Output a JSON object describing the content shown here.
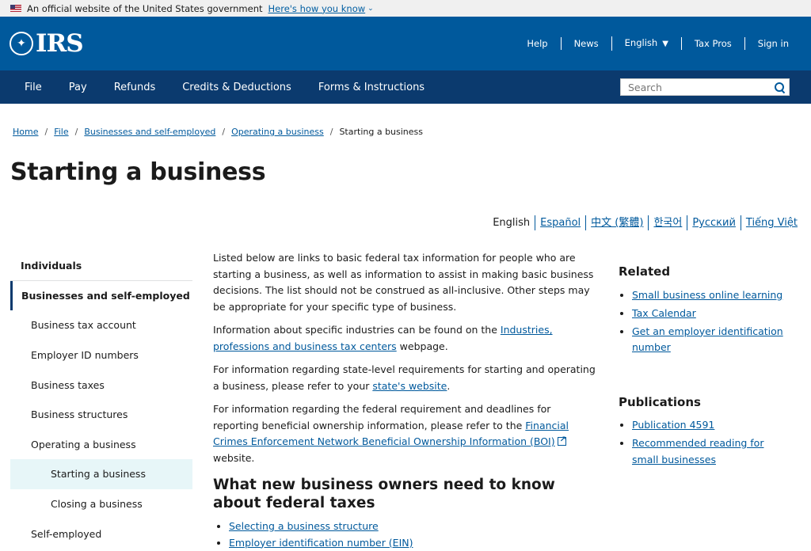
{
  "gov_banner": {
    "text": "An official website of the United States government",
    "link": "Here's how you know"
  },
  "header": {
    "logo_text": "IRS",
    "util_nav": [
      "Help",
      "News",
      "English",
      "Tax Pros",
      "Sign in"
    ]
  },
  "main_nav": {
    "items": [
      "File",
      "Pay",
      "Refunds",
      "Credits & Deductions",
      "Forms & Instructions"
    ],
    "search_placeholder": "Search"
  },
  "breadcrumb": {
    "items": [
      "Home",
      "File",
      "Businesses and self-employed",
      "Operating a business"
    ],
    "current": "Starting a business"
  },
  "page_title": "Starting a business",
  "languages": [
    "English",
    "Español",
    "中文 (繁體)",
    "한국어",
    "Русский",
    "Tiếng Việt"
  ],
  "sidebar": {
    "items": [
      "Individuals",
      "Businesses and self-employed",
      "Business tax account",
      "Employer ID numbers",
      "Business taxes",
      "Business structures",
      "Operating a business",
      "Starting a business",
      "Closing a business",
      "Self-employed"
    ]
  },
  "content": {
    "p1": "Listed below are links to basic federal tax information for people who are starting a business, as well as information to assist in making basic business decisions. The list should not be construed as all-inclusive. Other steps may be appropriate for your specific type of business.",
    "p2_pre": "Information about specific industries can be found on the ",
    "p2_link": "Industries, professions and business tax centers",
    "p2_post": " webpage.",
    "p3_pre": "For information regarding state-level requirements for starting and operating a business, please refer to your ",
    "p3_link": "state's website",
    "p3_post": ".",
    "p4_pre": "For information regarding the federal requirement and deadlines for reporting beneficial ownership information, please refer to the ",
    "p4_link": "Financial Crimes Enforcement Network Beneficial Ownership Information (BOI)",
    "p4_post": " website.",
    "h2": "What new business owners need to know about federal taxes",
    "links": [
      "Selecting a business structure",
      "Employer identification number (EIN)"
    ]
  },
  "rail": {
    "related_title": "Related",
    "related": [
      "Small business online learning",
      "Tax Calendar",
      "Get an employer identification number"
    ],
    "pubs_title": "Publications",
    "pubs": [
      "Publication 4591",
      "Recommended reading for small businesses"
    ]
  },
  "colors": {
    "header_blue": "#00599c",
    "nav_navy": "#0b3a6e",
    "link": "#00599c",
    "highlight": "#e7f6f8"
  }
}
